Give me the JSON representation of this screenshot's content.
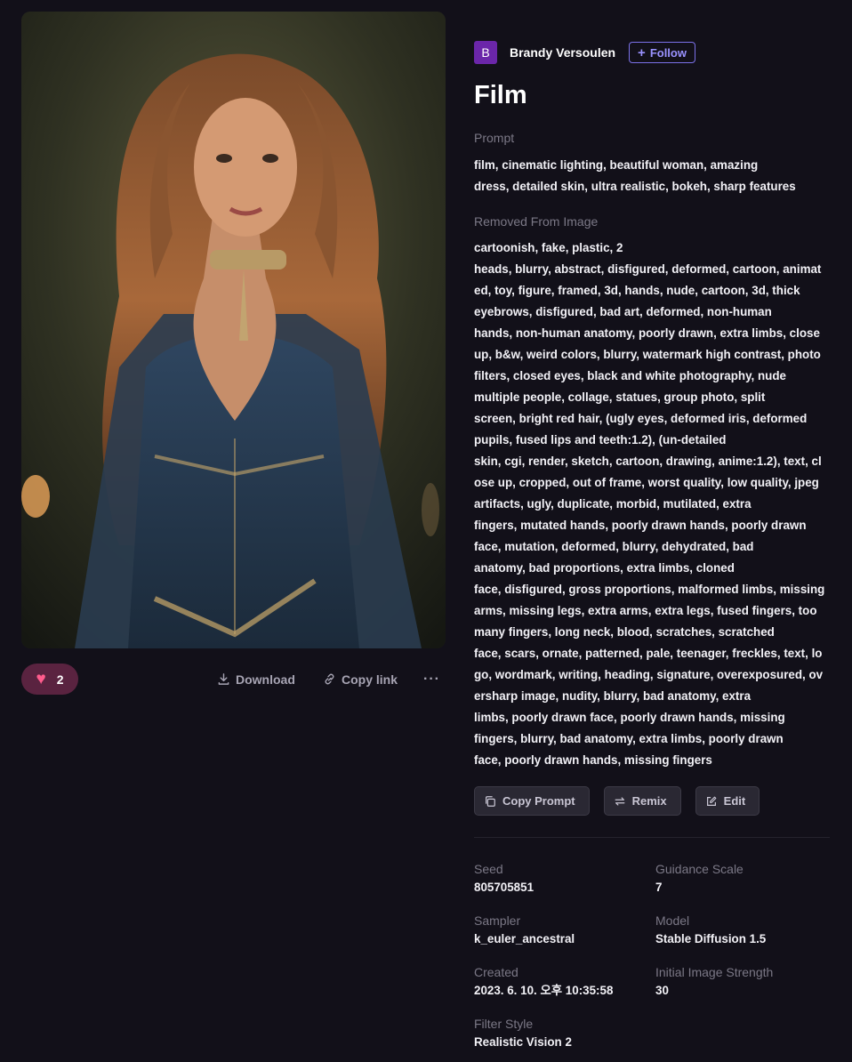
{
  "image": {
    "alt": ""
  },
  "actions": {
    "like_count": "2",
    "download_label": "Download",
    "copy_link_label": "Copy link",
    "more_label": "···"
  },
  "author": {
    "avatar_letter": "B",
    "name": "Brandy Versoulen",
    "follow_label": "Follow",
    "avatar_color": "#6b26a9"
  },
  "title": "Film",
  "prompt": {
    "label": "Prompt",
    "lines": [
      "film, cinematic lighting, beautiful woman, amazing",
      "dress, detailed skin, ultra realistic, bokeh, sharp features"
    ]
  },
  "removed": {
    "label": "Removed From Image",
    "lines": [
      "cartoonish, fake, plastic, 2",
      "heads, blurry, abstract, disfigured, deformed, cartoon, animat",
      "ed, toy, figure, framed, 3d, hands, nude, cartoon, 3d, thick",
      "eyebrows, disfigured, bad art, deformed, non-human",
      "hands, non-human anatomy, poorly drawn, extra limbs, close",
      "up, b&w, weird colors, blurry, watermark high contrast, photo",
      "filters, closed eyes, black and white photography, nude",
      "multiple people, collage, statues, group photo, split",
      "screen, bright red hair, (ugly eyes, deformed iris, deformed",
      "pupils, fused lips and teeth:1.2), (un-detailed",
      "skin, cgi, render, sketch, cartoon, drawing, anime:1.2), text, cl",
      "ose up, cropped, out of frame, worst quality, low quality, jpeg",
      "artifacts, ugly, duplicate, morbid, mutilated, extra",
      "fingers, mutated hands, poorly drawn hands, poorly drawn",
      "face, mutation, deformed, blurry, dehydrated, bad",
      "anatomy, bad proportions, extra limbs, cloned",
      "face, disfigured, gross proportions, malformed limbs, missing",
      "arms, missing legs, extra arms, extra legs, fused fingers, too",
      "many fingers, long neck, blood, scratches, scratched",
      "face, scars, ornate, patterned, pale, teenager, freckles, text, lo",
      "go, wordmark, writing, heading, signature, overexposured, ov",
      "ersharp image, nudity, blurry, bad anatomy, extra",
      "limbs, poorly drawn face, poorly drawn hands, missing",
      "fingers, blurry, bad anatomy, extra limbs, poorly drawn",
      "face, poorly drawn hands, missing fingers"
    ]
  },
  "buttons": {
    "copy_prompt": "Copy Prompt",
    "remix": "Remix",
    "edit": "Edit"
  },
  "meta": [
    {
      "key": "Seed",
      "value": "805705851"
    },
    {
      "key": "Guidance Scale",
      "value": "7"
    },
    {
      "key": "Sampler",
      "value": "k_euler_ancestral"
    },
    {
      "key": "Model",
      "value": "Stable Diffusion 1.5"
    },
    {
      "key": "Created",
      "value": "2023. 6. 10. 오후 10:35:58"
    },
    {
      "key": "Initial Image Strength",
      "value": "30"
    },
    {
      "key": "Filter Style",
      "value": "Realistic Vision 2"
    }
  ],
  "colors": {
    "background": "#121019",
    "accent": "#7b71e8",
    "like_bg": "#5a2340",
    "heart": "#ff5c8d"
  }
}
